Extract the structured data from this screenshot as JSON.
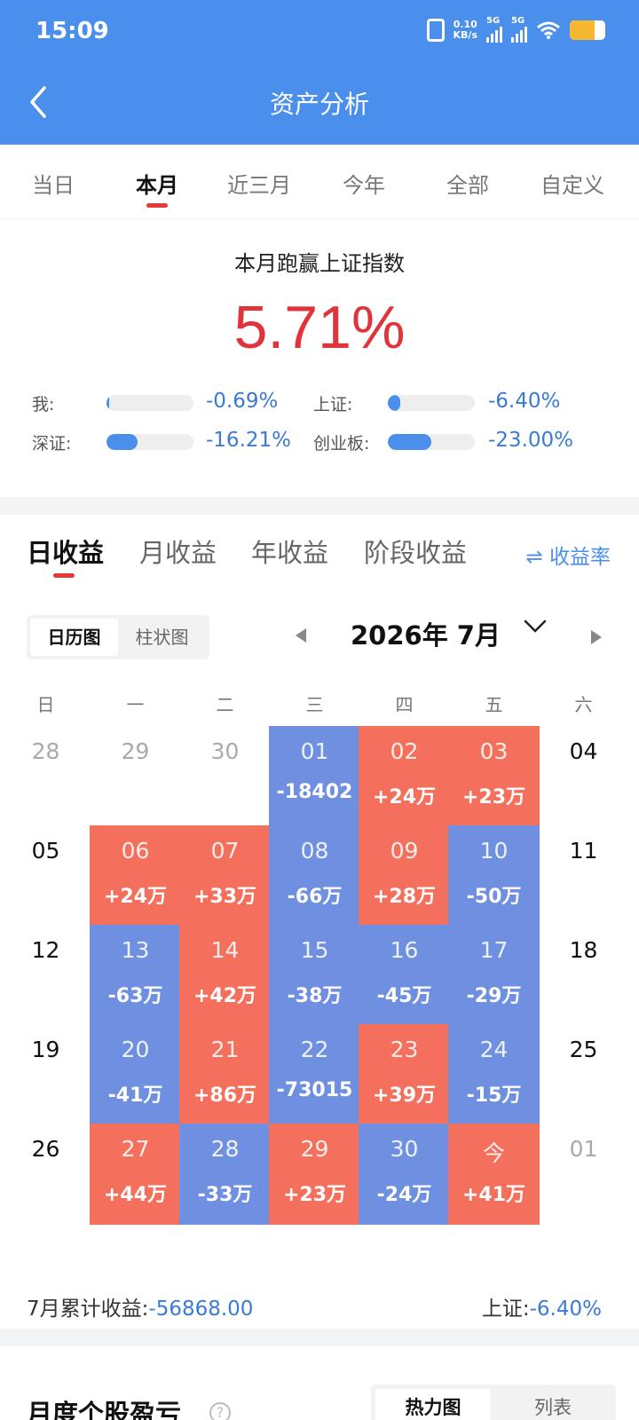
{
  "status": {
    "time": "15:09",
    "speed_value": "0.10",
    "speed_unit": "KB/s",
    "net1": "5G",
    "net2": "5G"
  },
  "header": {
    "title": "资产分析"
  },
  "periods": [
    {
      "label": "当日",
      "active": false
    },
    {
      "label": "本月",
      "active": true
    },
    {
      "label": "近三月",
      "active": false
    },
    {
      "label": "今年",
      "active": false
    },
    {
      "label": "全部",
      "active": false
    },
    {
      "label": "自定义",
      "active": false
    }
  ],
  "summary": {
    "title": "本月跑赢上证指数",
    "value": "5.71%",
    "comparisons": [
      {
        "label": "我:",
        "value": "-0.69%",
        "fill": 0.03
      },
      {
        "label": "上证:",
        "value": "-6.40%",
        "fill": 0.14
      },
      {
        "label": "深证:",
        "value": "-16.21%",
        "fill": 0.36
      },
      {
        "label": "创业板:",
        "value": "-23.00%",
        "fill": 0.5
      }
    ]
  },
  "earnings_tabs": [
    {
      "label": "日收益",
      "active": true
    },
    {
      "label": "月收益",
      "active": false
    },
    {
      "label": "年收益",
      "active": false
    },
    {
      "label": "阶段收益",
      "active": false
    }
  ],
  "rate_toggle": {
    "icon": "swap-arrows-icon",
    "label": "收益率"
  },
  "view_toggle": {
    "calendar": "日历图",
    "bar": "柱状图",
    "active": "calendar"
  },
  "month": {
    "label": "2026年 7月"
  },
  "weekdays": [
    "日",
    "一",
    "二",
    "三",
    "四",
    "五",
    "六"
  ],
  "colors": {
    "header": "#4a8feb",
    "gain": "#f4705d",
    "loss": "#6f8fe0",
    "accent_red": "#e0333b",
    "accent_blue": "#3a7bd5"
  },
  "calendar": [
    [
      {
        "day": "28",
        "value": "",
        "type": "other"
      },
      {
        "day": "29",
        "value": "",
        "type": "other"
      },
      {
        "day": "30",
        "value": "",
        "type": "other"
      },
      {
        "day": "01",
        "value": "-18402",
        "type": "down"
      },
      {
        "day": "02",
        "value": "+24万",
        "type": "up"
      },
      {
        "day": "03",
        "value": "+23万",
        "type": "up"
      },
      {
        "day": "04",
        "value": "",
        "type": "plain"
      }
    ],
    [
      {
        "day": "05",
        "value": "",
        "type": "plain"
      },
      {
        "day": "06",
        "value": "+24万",
        "type": "up"
      },
      {
        "day": "07",
        "value": "+33万",
        "type": "up"
      },
      {
        "day": "08",
        "value": "-66万",
        "type": "down"
      },
      {
        "day": "09",
        "value": "+28万",
        "type": "up"
      },
      {
        "day": "10",
        "value": "-50万",
        "type": "down"
      },
      {
        "day": "11",
        "value": "",
        "type": "plain"
      }
    ],
    [
      {
        "day": "12",
        "value": "",
        "type": "plain"
      },
      {
        "day": "13",
        "value": "-63万",
        "type": "down"
      },
      {
        "day": "14",
        "value": "+42万",
        "type": "up"
      },
      {
        "day": "15",
        "value": "-38万",
        "type": "down"
      },
      {
        "day": "16",
        "value": "-45万",
        "type": "down"
      },
      {
        "day": "17",
        "value": "-29万",
        "type": "down"
      },
      {
        "day": "18",
        "value": "",
        "type": "plain"
      }
    ],
    [
      {
        "day": "19",
        "value": "",
        "type": "plain"
      },
      {
        "day": "20",
        "value": "-41万",
        "type": "down"
      },
      {
        "day": "21",
        "value": "+86万",
        "type": "up"
      },
      {
        "day": "22",
        "value": "-73015",
        "type": "down"
      },
      {
        "day": "23",
        "value": "+39万",
        "type": "up"
      },
      {
        "day": "24",
        "value": "-15万",
        "type": "down"
      },
      {
        "day": "25",
        "value": "",
        "type": "plain"
      }
    ],
    [
      {
        "day": "26",
        "value": "",
        "type": "plain"
      },
      {
        "day": "27",
        "value": "+44万",
        "type": "up"
      },
      {
        "day": "28",
        "value": "-33万",
        "type": "down"
      },
      {
        "day": "29",
        "value": "+23万",
        "type": "up"
      },
      {
        "day": "30",
        "value": "-24万",
        "type": "down"
      },
      {
        "day": "今",
        "value": "+41万",
        "type": "up"
      },
      {
        "day": "01",
        "value": "",
        "type": "other"
      }
    ]
  ],
  "footer": {
    "cum_label": "7月累计收益:",
    "cum_value": "-56868.00",
    "sh_label": "上证:",
    "sh_value": "-6.40%"
  },
  "bottom": {
    "title": "月度个股盈亏",
    "help": "?",
    "heatmap": "热力图",
    "list": "列表",
    "active": "heatmap"
  }
}
